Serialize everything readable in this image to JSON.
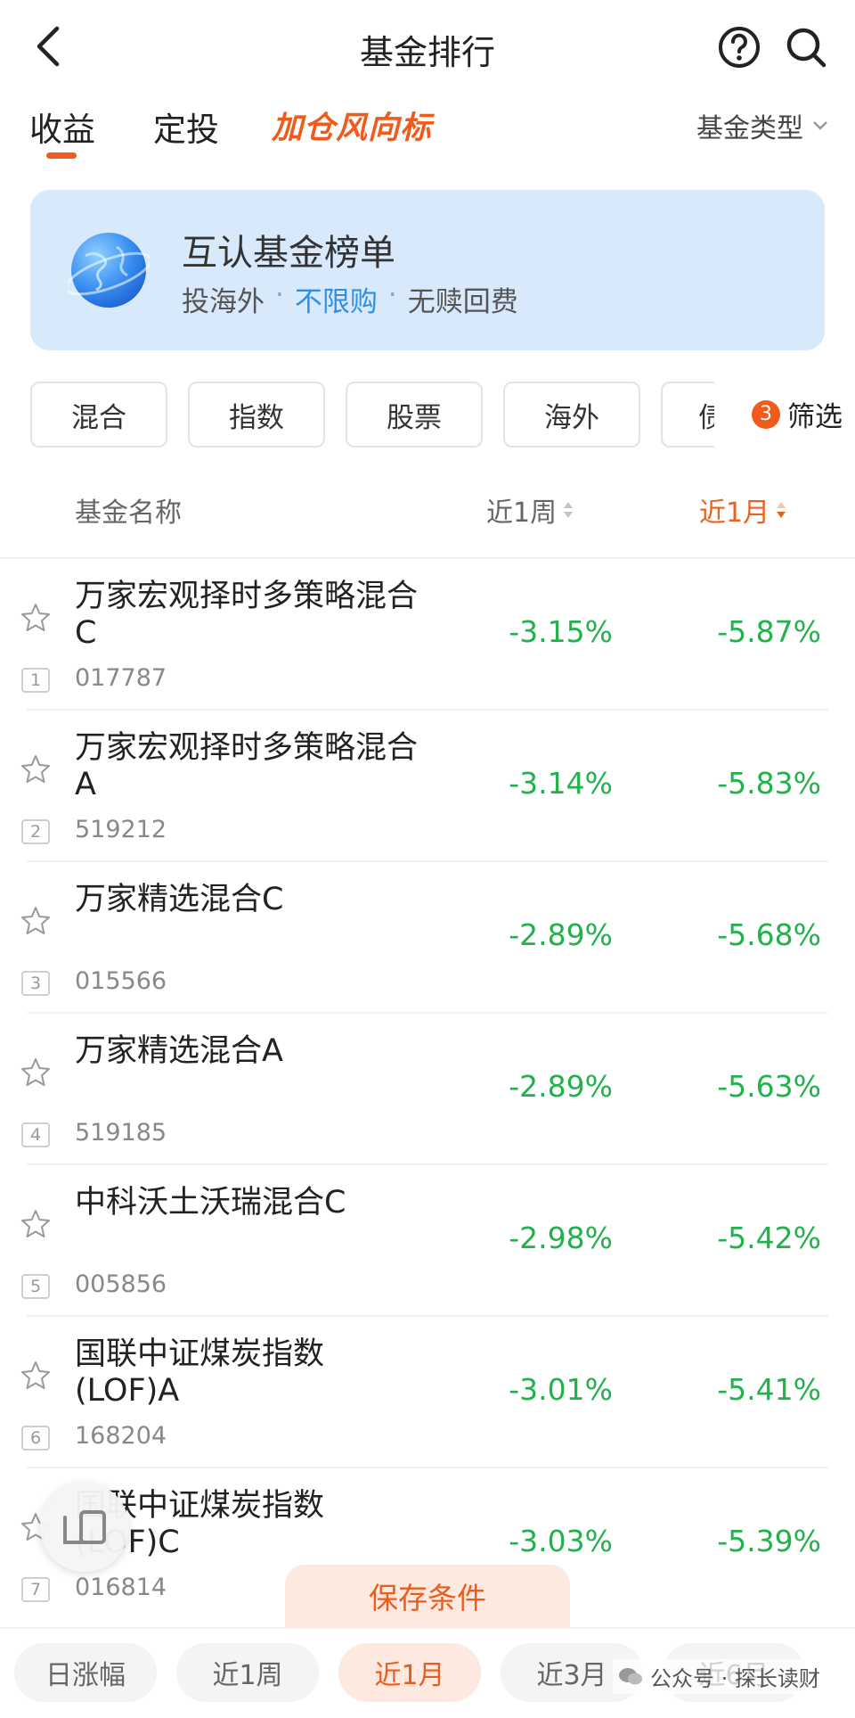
{
  "header": {
    "title": "基金排行"
  },
  "tabs": {
    "income": "收益",
    "fixed": "定投",
    "promo": "加仓风向标",
    "fund_type": "基金类型"
  },
  "banner": {
    "title": "互认基金榜单",
    "sub1": "投海外",
    "sub2": "不限购",
    "sub3": "无赎回费",
    "dot": "·"
  },
  "filters": {
    "chips": [
      "混合",
      "指数",
      "股票",
      "海外",
      "债"
    ],
    "filter_count": "3",
    "filter_label": "筛选"
  },
  "columns": {
    "name": "基金名称",
    "week": "近1周",
    "month": "近1月"
  },
  "funds": [
    {
      "rank": "1",
      "name": "万家宏观择时多策略混合C",
      "code": "017787",
      "week": "-3.15%",
      "month": "-5.87%"
    },
    {
      "rank": "2",
      "name": "万家宏观择时多策略混合A",
      "code": "519212",
      "week": "-3.14%",
      "month": "-5.83%"
    },
    {
      "rank": "3",
      "name": "万家精选混合C",
      "code": "015566",
      "week": "-2.89%",
      "month": "-5.68%"
    },
    {
      "rank": "4",
      "name": "万家精选混合A",
      "code": "519185",
      "week": "-2.89%",
      "month": "-5.63%"
    },
    {
      "rank": "5",
      "name": "中科沃土沃瑞混合C",
      "code": "005856",
      "week": "-2.98%",
      "month": "-5.42%"
    },
    {
      "rank": "6",
      "name": "国联中证煤炭指数(LOF)A",
      "code": "168204",
      "week": "-3.01%",
      "month": "-5.41%"
    },
    {
      "rank": "7",
      "name": "国联中证煤炭指数(LOF)C",
      "code": "016814",
      "week": "-3.03%",
      "month": "-5.39%"
    }
  ],
  "save_button": "保存条件",
  "periods": [
    "日涨幅",
    "近1周",
    "近1月",
    "近3月",
    "近6月"
  ],
  "watermark": "公众号 · 探长读财",
  "colors": {
    "accent": "#f25a1c",
    "negative": "#22b14c",
    "banner_bg": "#d7e9fb"
  }
}
